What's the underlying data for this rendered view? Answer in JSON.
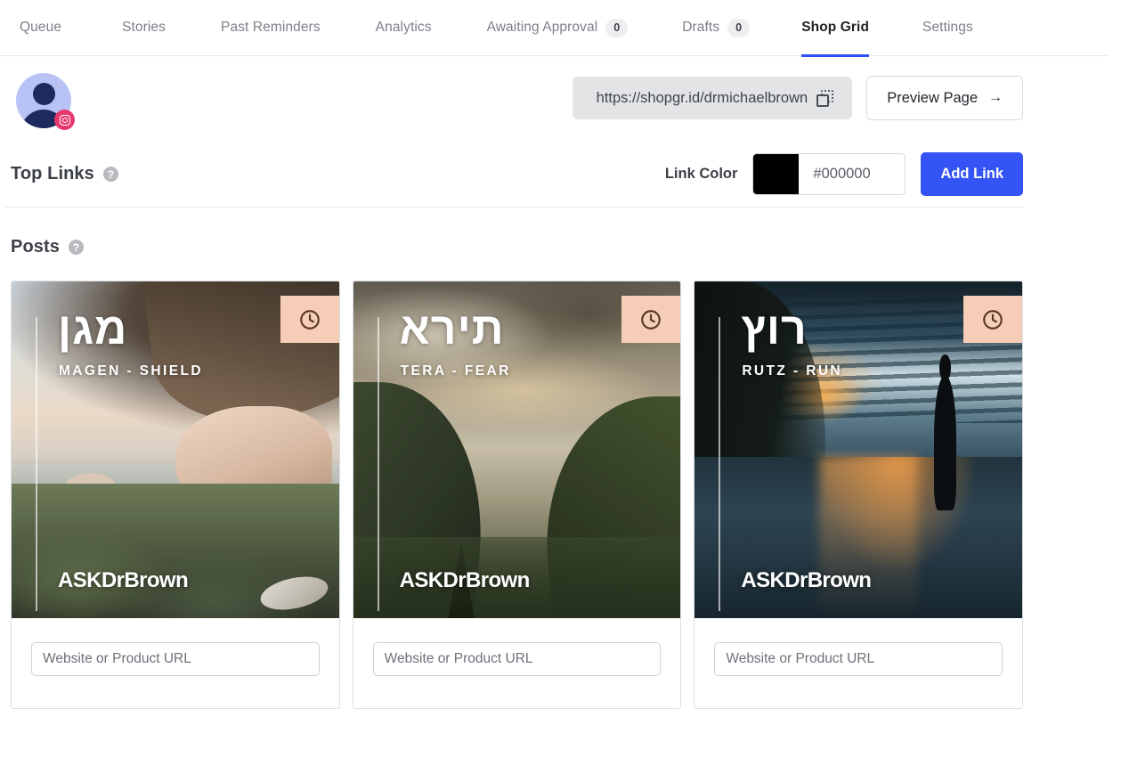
{
  "nav": {
    "tabs": [
      {
        "label": "Queue",
        "badge": null,
        "active": false
      },
      {
        "label": "Stories",
        "badge": null,
        "active": false
      },
      {
        "label": "Past Reminders",
        "badge": null,
        "active": false
      },
      {
        "label": "Analytics",
        "badge": null,
        "active": false
      },
      {
        "label": "Awaiting Approval",
        "badge": "0",
        "active": false
      },
      {
        "label": "Drafts",
        "badge": "0",
        "active": false
      },
      {
        "label": "Shop Grid",
        "badge": null,
        "active": true
      },
      {
        "label": "Settings",
        "badge": null,
        "active": false
      }
    ],
    "active_underline_color": "#2f4ff0"
  },
  "account": {
    "avatar_icon": "user-avatar",
    "platform_badge_icon": "instagram-icon",
    "platform_badge_color": "#e8386e",
    "shop_url": "https://shopgr.id/drmichaelbrown",
    "copy_icon": "copy-icon",
    "preview_label": "Preview Page",
    "preview_arrow_icon": "arrow-right-icon",
    "preview_arrow_glyph": "→"
  },
  "top_links": {
    "title": "Top Links",
    "help_icon": "help-icon",
    "help_glyph": "?",
    "link_color_label": "Link Color",
    "link_color_value": "#000000",
    "link_color_swatch": "#000000",
    "add_link_label": "Add Link",
    "add_link_color": "#3554f5"
  },
  "posts": {
    "title": "Posts",
    "help_icon": "help-icon",
    "help_glyph": "?",
    "url_placeholder": "Website or Product URL",
    "badge_icon": "clock-icon",
    "badge_color": "#f6cdb6",
    "brand": "ASKDrBrown",
    "cards": [
      {
        "hebrew": "מגן",
        "transliteration": "MAGEN - SHIELD",
        "brand": "ASKDrBrown",
        "scene": "beach-cave-sunset",
        "url_value": ""
      },
      {
        "hebrew": "תירא",
        "transliteration": "TERA - FEAR",
        "brand": "ASKDrBrown",
        "scene": "mountain-valley-clouds",
        "url_value": ""
      },
      {
        "hebrew": "רוץ",
        "transliteration": "RUTZ - RUN",
        "brand": "ASKDrBrown",
        "scene": "runner-wet-road-dusk",
        "url_value": ""
      }
    ]
  }
}
